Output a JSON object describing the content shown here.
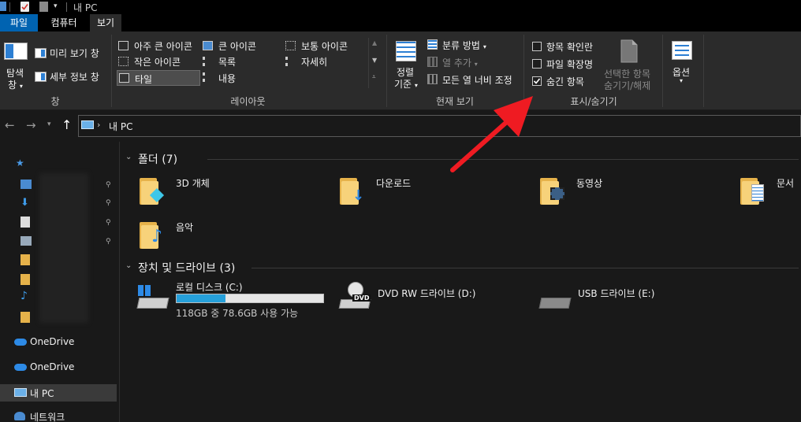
{
  "window": {
    "title": "내 PC"
  },
  "tabs": [
    {
      "label": "파일",
      "active": true
    },
    {
      "label": "컴퓨터",
      "active": false
    },
    {
      "label": "보기",
      "active": false
    }
  ],
  "ribbon": {
    "pane_group": {
      "nav_pane_label_line1": "탐색",
      "nav_pane_label_line2": "창",
      "preview_pane": "미리 보기 창",
      "details_pane": "세부 정보 창",
      "group_label": "창"
    },
    "layout_group": {
      "items": [
        "아주 큰 아이콘",
        "큰 아이콘",
        "보통 아이콘",
        "작은 아이콘",
        "목록",
        "자세히",
        "타일",
        "내용"
      ],
      "selected": "타일",
      "group_label": "레이아웃"
    },
    "current_view_group": {
      "sort_label_line1": "정렬",
      "sort_label_line2": "기준",
      "group_by": "분류 방법",
      "add_columns": "열 추가",
      "size_all_columns": "모든 열 너비 조정",
      "group_label": "현재 보기"
    },
    "show_hide_group": {
      "item_checkboxes": "항목 확인란",
      "file_extensions": "파일 확장명",
      "hidden_items": "숨긴 항목",
      "hide_selected_line1": "선택한 항목",
      "hide_selected_line2": "숨기기/해제",
      "group_label": "표시/숨기기",
      "item_checkboxes_checked": false,
      "file_extensions_checked": false,
      "hidden_items_checked": true
    },
    "options_label": "옵션"
  },
  "address_bar": {
    "path": "내 PC"
  },
  "nav_pane": {
    "items": [
      {
        "label": "OneDrive",
        "icon": "cloud-icon"
      },
      {
        "label": "OneDrive",
        "icon": "cloud-icon"
      },
      {
        "label": "내 PC",
        "icon": "computer-icon",
        "selected": true
      },
      {
        "label": "네트워크",
        "icon": "network-icon"
      }
    ]
  },
  "content": {
    "folders_section": {
      "title": "폴더 (7)",
      "items": [
        {
          "label": "3D 개체",
          "icon": "3d-objects-folder-icon"
        },
        {
          "label": "다운로드",
          "icon": "downloads-folder-icon"
        },
        {
          "label": "동영상",
          "icon": "videos-folder-icon"
        },
        {
          "label": "문서",
          "icon": "documents-folder-icon"
        },
        {
          "label": "음악",
          "icon": "music-folder-icon"
        }
      ]
    },
    "drives_section": {
      "title": "장치 및 드라이브 (3)",
      "items": [
        {
          "label": "로컬 디스크 (C:)",
          "icon": "local-disk-icon",
          "details": "118GB 중 78.6GB 사용 가능",
          "used_fraction": 0.334
        },
        {
          "label": "DVD RW 드라이브 (D:)",
          "icon": "dvd-drive-icon",
          "badge": "DVD"
        },
        {
          "label": "USB 드라이브 (E:)",
          "icon": "usb-drive-icon"
        }
      ]
    }
  },
  "colors": {
    "accent": "#0063b1",
    "arrow": "#ef1b22",
    "progress": "#26a0da"
  }
}
